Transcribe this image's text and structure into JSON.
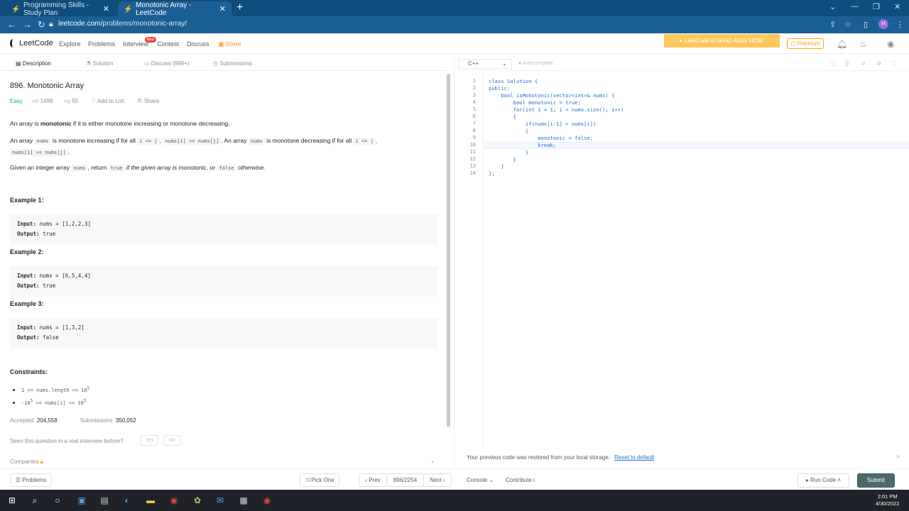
{
  "browser": {
    "tabs": [
      {
        "label": "Programming Skills - Study Plan"
      },
      {
        "label": "Monotonic Array - LeetCode"
      }
    ],
    "url_domain": "leetcode.com",
    "url_path": "/problems/monotonic-array/",
    "profile_initial": "H"
  },
  "header": {
    "logo": "LeetCode",
    "nav": [
      "Explore",
      "Problems",
      "Interview",
      "Contest",
      "Discuss",
      "Store"
    ],
    "interview_badge": "New",
    "banner": "LeetCode is hiring! Apply NOW.",
    "premium": "Premium"
  },
  "left_tabs": [
    "Description",
    "Solution",
    "Discuss (999+)",
    "Submissions"
  ],
  "problem": {
    "title": "896. Monotonic Array",
    "difficulty": "Easy",
    "likes": "1498",
    "dislikes": "55",
    "add_to_list": "Add to List",
    "share": "Share",
    "p1_a": "An array is ",
    "p1_b": "monotonic",
    "p1_c": " if it is either monotone increasing or monotone decreasing.",
    "p2_a": "An array ",
    "p2_code1": "nums",
    "p2_b": " is monotone increasing if for all ",
    "p2_code2": "i <= j",
    "p2_c": ", ",
    "p2_code3": "nums[i] <= nums[j]",
    "p2_d": ". An array ",
    "p2_code4": "nums",
    "p2_e": " is monotone decreasing if for all ",
    "p2_code5": "i <= j",
    "p2_f": ",",
    "p2_code6": "nums[i] >= nums[j]",
    "p2_g": ".",
    "p3_a": "Given an integer array ",
    "p3_code1": "nums",
    "p3_b": ", return ",
    "p3_code2": "true",
    "p3_c": " if the given array is monotonic, or ",
    "p3_code3": "false",
    "p3_d": " otherwise.",
    "examples": [
      {
        "heading": "Example 1:",
        "input": "nums = [1,2,2,3]",
        "output": "true"
      },
      {
        "heading": "Example 2:",
        "input": "nums = [6,5,4,4]",
        "output": "true"
      },
      {
        "heading": "Example 3:",
        "input": "nums = [1,3,2]",
        "output": "false"
      }
    ],
    "input_label": "Input:",
    "output_label": "Output:",
    "constraints_heading": "Constraints:",
    "constraint1_a": "1 <= nums.length <= 10",
    "constraint1_sup": "5",
    "constraint2_a": "-10",
    "constraint2_sup1": "5",
    "constraint2_b": " <= nums[i] <= 10",
    "constraint2_sup2": "5",
    "accepted_label": "Accepted",
    "accepted_value": "204,558",
    "submissions_label": "Submissions",
    "submissions_value": "350,052",
    "interview_q": "Seen this question in a real interview before?",
    "yes": "Yes",
    "no": "No",
    "companies": "Companies"
  },
  "left_footer": {
    "problems": "Problems",
    "pick_one": "Pick One",
    "prev": "Prev",
    "page": "896/2254",
    "next": "Next"
  },
  "editor": {
    "language": "C++",
    "autocomplete": "Autocomplete",
    "lines": [
      "class Solution {",
      "public:",
      "    bool isMonotonic(vector<int>& nums) {",
      "        bool monotonic = true;",
      "        for(int i = 1; i < nums.size(); i++)",
      "        {",
      "            if(nums[i-1] > nums[i])",
      "            {",
      "                monotonic = false;",
      "                break;",
      "            }",
      "        }",
      "    }",
      "};"
    ],
    "line_numbers": [
      "1",
      "2",
      "3",
      "4",
      "5",
      "6",
      "7",
      "8",
      "9",
      "10",
      "11",
      "12",
      "13",
      "14"
    ],
    "restore_msg": "Your previous code was restored from your local storage.",
    "reset_link": "Reset to default",
    "console": "Console",
    "contribute": "Contribute",
    "run_code": "Run Code",
    "submit": "Submit"
  },
  "taskbar": {
    "time": "2:01 PM",
    "date": "4/30/2022"
  }
}
